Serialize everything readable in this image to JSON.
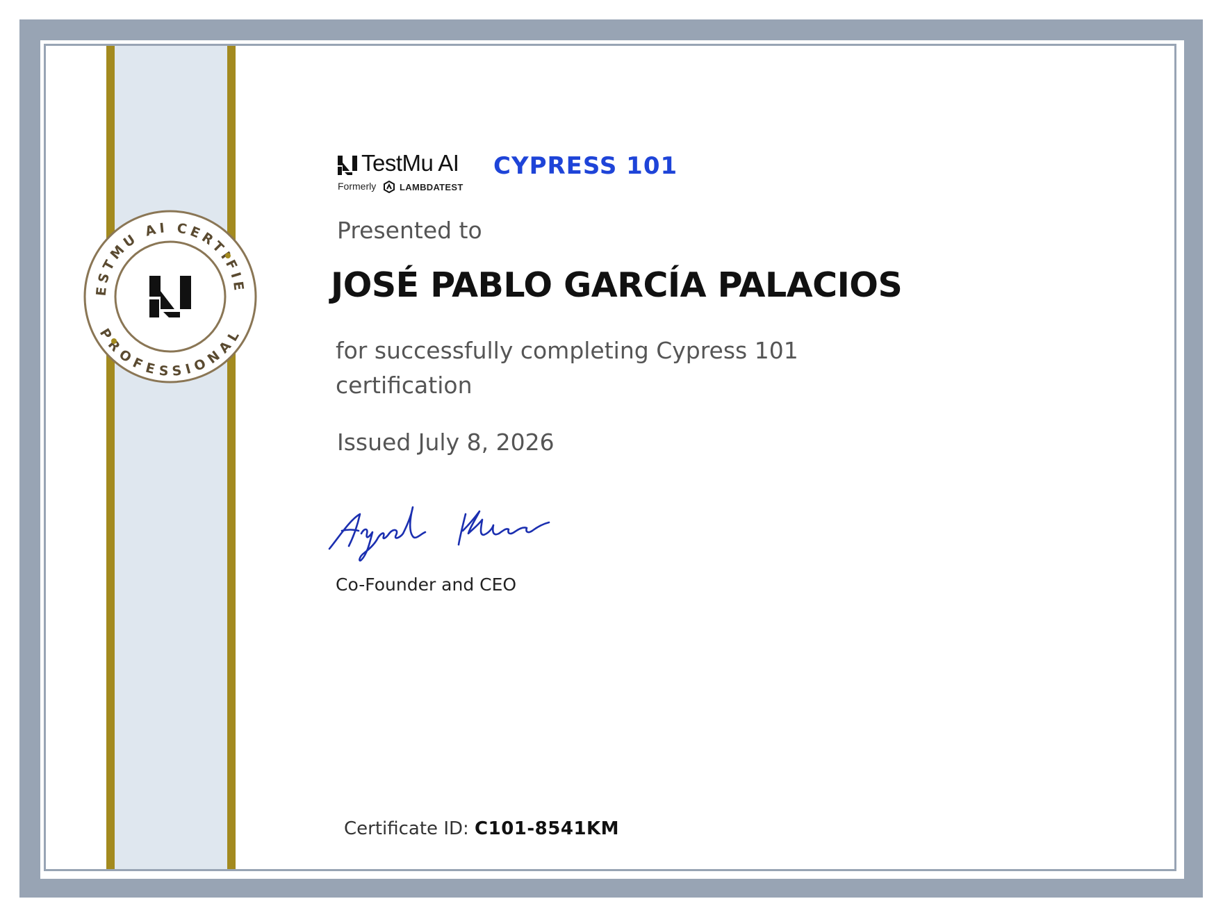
{
  "brand": {
    "name": "TestMu AI",
    "formerly_label": "Formerly",
    "former_name": "LAMBDATEST",
    "accent_color": "#1e44d8",
    "ribbon_gold": "#a38a1f"
  },
  "seal": {
    "top_arc_text": "TESTMU AI CERTIFIED",
    "bottom_arc_text": "PROFESSIONAL"
  },
  "course": {
    "title": "CYPRESS 101"
  },
  "certificate": {
    "presented_label": "Presented to",
    "recipient_name": "JOSÉ PABLO GARCÍA PALACIOS",
    "reason": "for successfully completing Cypress 101 certification",
    "issued": "Issued July 8, 2026",
    "signer_title": "Co-Founder and CEO",
    "id_label": "Certificate ID: ",
    "id_value": "C101-8541KM"
  }
}
